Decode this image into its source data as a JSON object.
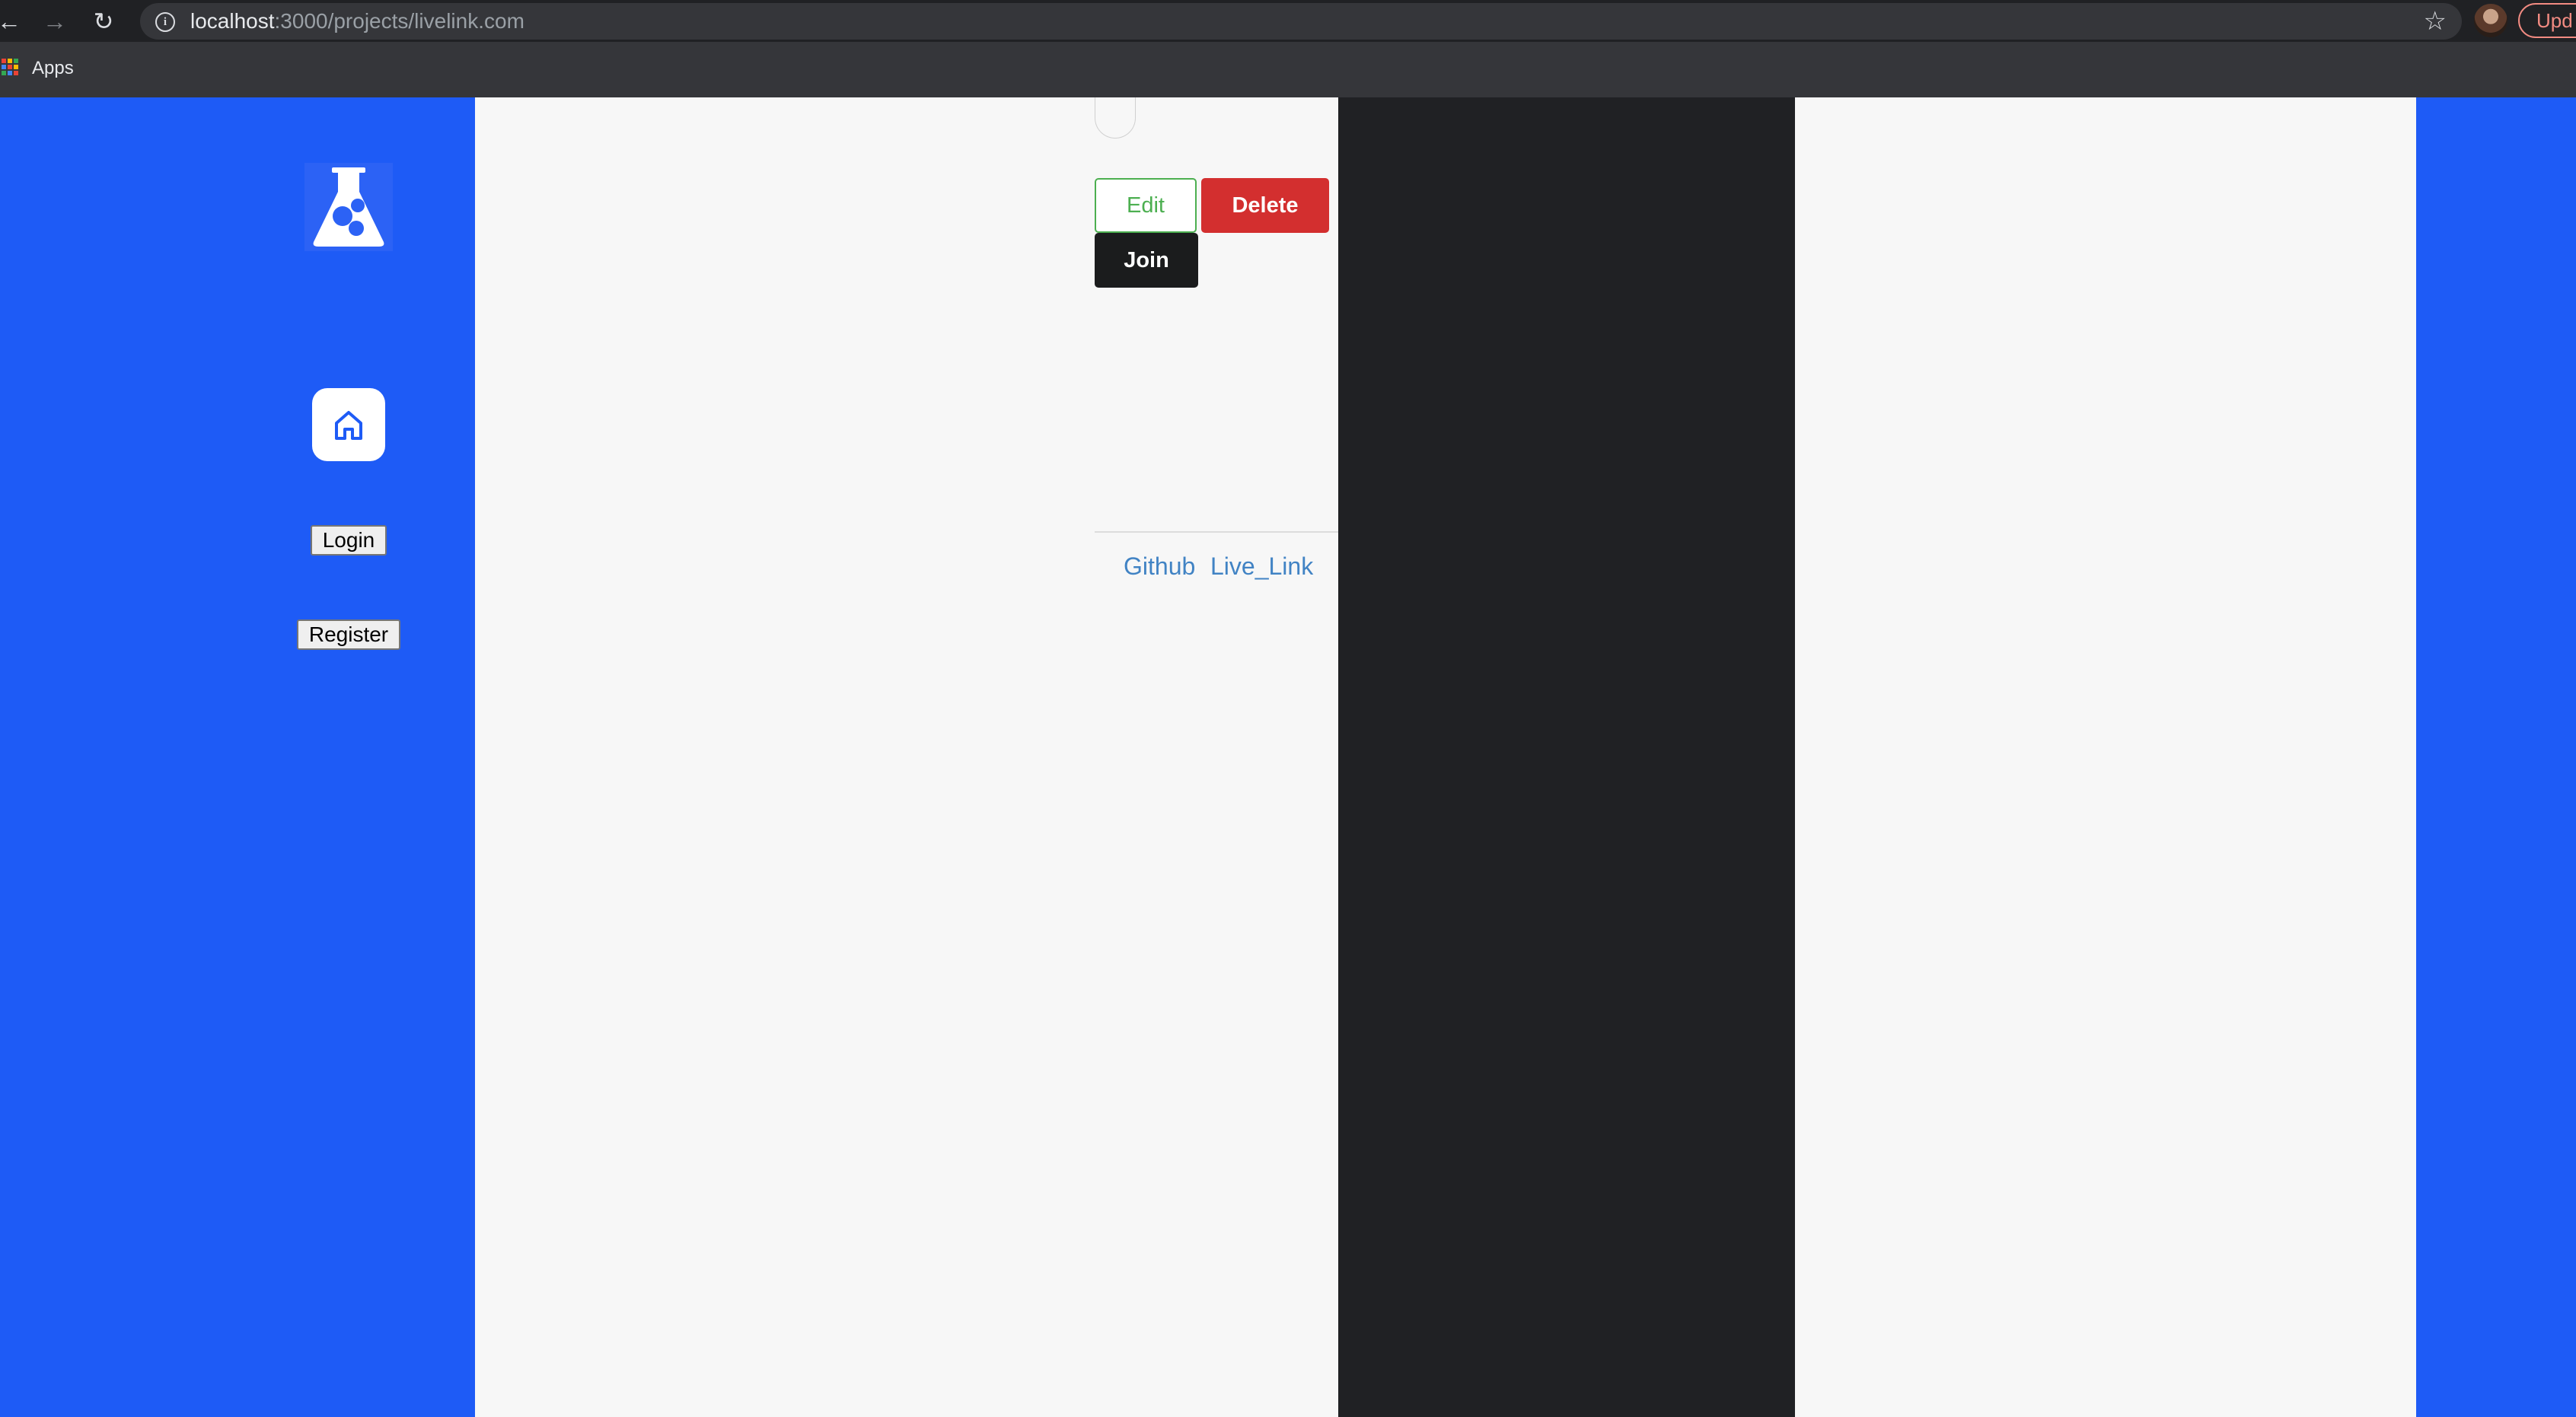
{
  "browser": {
    "url_host": "localhost",
    "url_path": ":3000/projects/livelink.com",
    "bookmarks_apps_label": "Apps",
    "update_label": "Upd",
    "apps_colors": [
      "#ea4335",
      "#fbbc04",
      "#34a853",
      "#4285f4",
      "#ea4335",
      "#fbbc04",
      "#34a853",
      "#4285f4",
      "#ea4335"
    ]
  },
  "sidebar": {
    "login_label": "Login",
    "register_label": "Register"
  },
  "project": {
    "edit_label": "Edit",
    "delete_label": "Delete",
    "join_label": "Join",
    "github_label": "Github",
    "livelink_label": "Live_Link"
  },
  "colors": {
    "primary_blue": "#1e5bf6",
    "edit_green": "#4caf50",
    "delete_red": "#d32f2f",
    "join_black": "#1b1c1d",
    "link_blue": "#4183c4",
    "dark_panel": "#202124"
  }
}
